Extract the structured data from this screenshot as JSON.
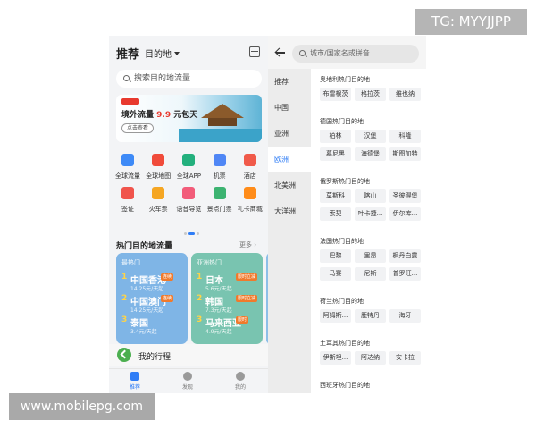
{
  "watermarks": {
    "tg": "TG: MYYJJPP",
    "site": "www.mobilepg.com"
  },
  "left": {
    "header": {
      "title": "推荐",
      "destination": "目的地"
    },
    "search": {
      "placeholder": "搜索目的地流量"
    },
    "banner": {
      "title_prefix": "境外流量 ",
      "price": "9.9",
      "title_suffix": " 元包天",
      "button": "点击查看"
    },
    "services": [
      {
        "label": "全球流量",
        "icon": "global-data-icon",
        "color": "#3d8af7"
      },
      {
        "label": "全球地图",
        "icon": "map-pin-icon",
        "color": "#f04b3a"
      },
      {
        "label": "全球APP",
        "icon": "app-store-icon",
        "color": "#23b07d"
      },
      {
        "label": "机票",
        "icon": "airplane-icon",
        "color": "#4f86f5"
      },
      {
        "label": "酒店",
        "icon": "hotel-icon",
        "color": "#f05a4a"
      },
      {
        "label": "签证",
        "icon": "visa-icon",
        "color": "#f0544c"
      },
      {
        "label": "火车票",
        "icon": "train-icon",
        "color": "#f5a623"
      },
      {
        "label": "语音导览",
        "icon": "headphones-icon",
        "color": "#f25c7a"
      },
      {
        "label": "景点门票",
        "icon": "ticket-icon",
        "color": "#3cb371"
      },
      {
        "label": "礼卡商城",
        "icon": "gift-icon",
        "color": "#ff8c1a"
      }
    ],
    "hot": {
      "title": "热门目的地流量",
      "more": "更多",
      "cards": [
        {
          "title": "最热门",
          "items": [
            {
              "rank": "1",
              "city": "中国香港",
              "price": "14.25元/天起",
              "tag": "连续"
            },
            {
              "rank": "2",
              "city": "中国澳门",
              "price": "14.25元/天起",
              "tag": "连续"
            },
            {
              "rank": "3",
              "city": "泰国",
              "price": "3.4元/天起",
              "tag": ""
            }
          ]
        },
        {
          "title": "亚洲热门",
          "items": [
            {
              "rank": "1",
              "city": "日本",
              "price": "5.6元/天起",
              "tag": "限时立减"
            },
            {
              "rank": "2",
              "city": "韩国",
              "price": "7.3元/天起",
              "tag": "限时立减"
            },
            {
              "rank": "3",
              "city": "马来西亚",
              "price": "4.9元/天起",
              "tag": "限时"
            }
          ]
        }
      ]
    },
    "trip": "我的行程",
    "nav": [
      {
        "label": "推荐",
        "active": true
      },
      {
        "label": "发现",
        "active": false
      },
      {
        "label": "我的",
        "active": false
      }
    ]
  },
  "right": {
    "search": {
      "placeholder": "城市/国家名或拼音"
    },
    "regions": [
      {
        "label": "推荐",
        "active": false
      },
      {
        "label": "中国",
        "active": false
      },
      {
        "label": "亚洲",
        "active": false
      },
      {
        "label": "欧洲",
        "active": true
      },
      {
        "label": "北美洲",
        "active": false
      },
      {
        "label": "大洋洲",
        "active": false
      }
    ],
    "sections": [
      {
        "title": "奥地利热门目的地",
        "cities": [
          "布雷根茨",
          "格拉茨",
          "维也纳"
        ]
      },
      {
        "title": "德国热门目的地",
        "cities": [
          "柏林",
          "汉堡",
          "科隆",
          "慕尼黑",
          "海德堡",
          "斯图加特"
        ]
      },
      {
        "title": "俄罗斯热门目的地",
        "cities": [
          "莫斯科",
          "喀山",
          "圣彼得堡",
          "索契",
          "叶卡捷...",
          "伊尔库..."
        ]
      },
      {
        "title": "法国热门目的地",
        "cities": [
          "巴黎",
          "里昂",
          "枫丹白露",
          "马赛",
          "尼斯",
          "普罗旺..."
        ]
      },
      {
        "title": "荷兰热门目的地",
        "cities": [
          "阿姆斯...",
          "鹿特丹",
          "海牙"
        ]
      },
      {
        "title": "土耳其热门目的地",
        "cities": [
          "伊斯坦...",
          "阿达纳",
          "安卡拉"
        ]
      },
      {
        "title": "西班牙热门目的地",
        "cities": [
          "巴塞罗那",
          "马德里",
          "塞维利亚"
        ]
      }
    ]
  }
}
